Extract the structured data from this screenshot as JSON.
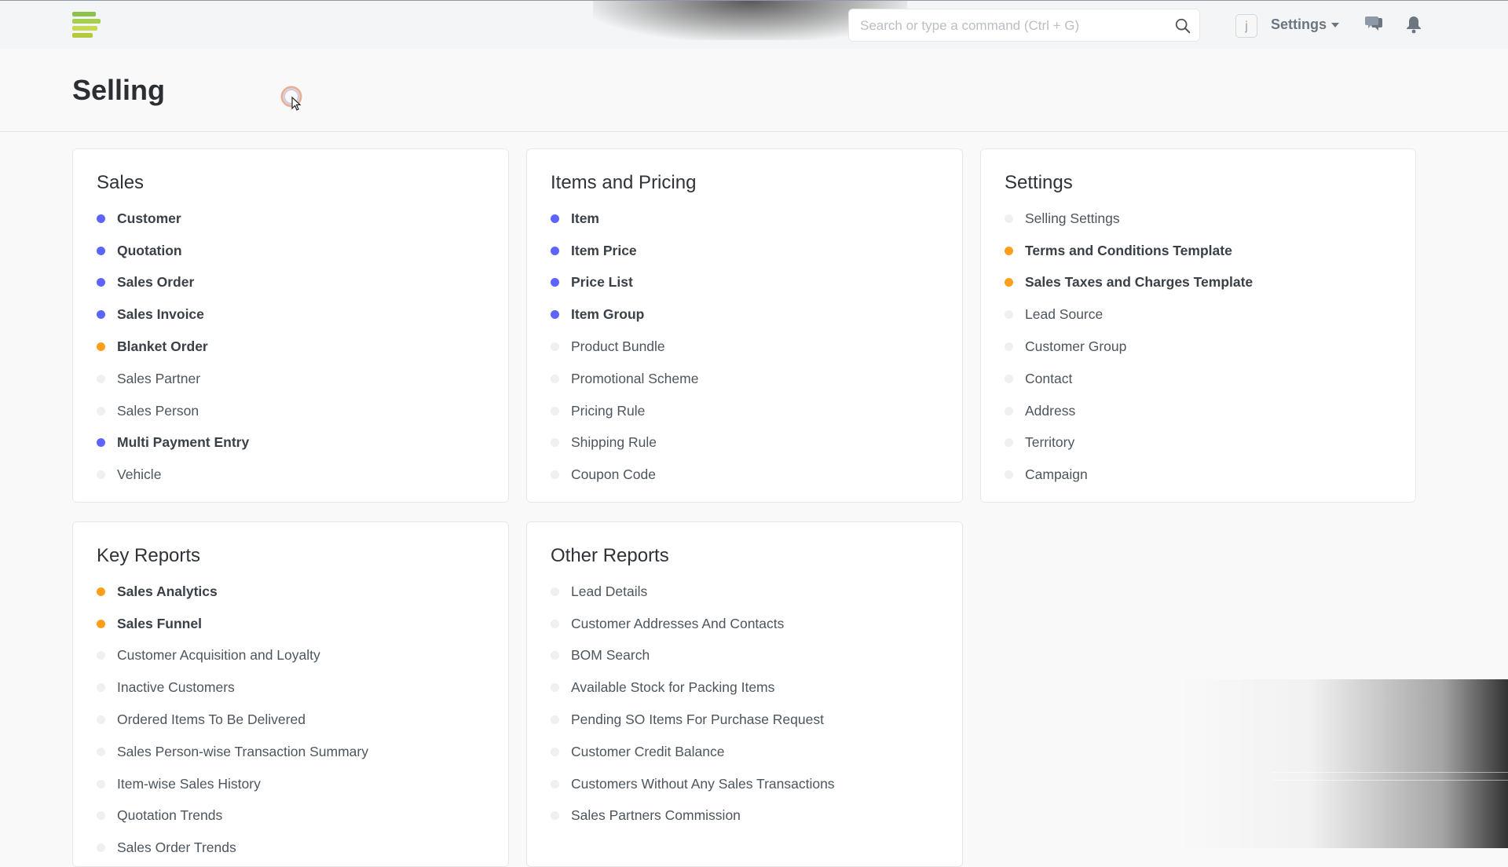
{
  "navbar": {
    "search_placeholder": "Search or type a command (Ctrl + G)",
    "avatar_initial": "j",
    "settings_label": "Settings",
    "icons": [
      "app-logo-icon",
      "search-icon",
      "chat-icon",
      "bell-icon",
      "chevron-down-icon"
    ]
  },
  "page": {
    "title": "Selling"
  },
  "colors": {
    "blue_dot": "#5e64ff",
    "orange_dot": "#ff9e1b",
    "grey_dot": "#eef0f2"
  },
  "cards": {
    "sales": {
      "title": "Sales",
      "links": [
        {
          "label": "Customer",
          "dot": "blue"
        },
        {
          "label": "Quotation",
          "dot": "blue"
        },
        {
          "label": "Sales Order",
          "dot": "blue"
        },
        {
          "label": "Sales Invoice",
          "dot": "blue"
        },
        {
          "label": "Blanket Order",
          "dot": "orange"
        },
        {
          "label": "Sales Partner",
          "dot": "grey"
        },
        {
          "label": "Sales Person",
          "dot": "grey"
        },
        {
          "label": "Multi Payment Entry",
          "dot": "blue"
        },
        {
          "label": "Vehicle",
          "dot": "grey"
        }
      ]
    },
    "items_pricing": {
      "title": "Items and Pricing",
      "links": [
        {
          "label": "Item",
          "dot": "blue"
        },
        {
          "label": "Item Price",
          "dot": "blue"
        },
        {
          "label": "Price List",
          "dot": "blue"
        },
        {
          "label": "Item Group",
          "dot": "blue"
        },
        {
          "label": "Product Bundle",
          "dot": "grey"
        },
        {
          "label": "Promotional Scheme",
          "dot": "grey"
        },
        {
          "label": "Pricing Rule",
          "dot": "grey"
        },
        {
          "label": "Shipping Rule",
          "dot": "grey"
        },
        {
          "label": "Coupon Code",
          "dot": "grey"
        }
      ]
    },
    "settings": {
      "title": "Settings",
      "links": [
        {
          "label": "Selling Settings",
          "dot": "grey"
        },
        {
          "label": "Terms and Conditions Template",
          "dot": "orange"
        },
        {
          "label": "Sales Taxes and Charges Template",
          "dot": "orange"
        },
        {
          "label": "Lead Source",
          "dot": "grey"
        },
        {
          "label": "Customer Group",
          "dot": "grey"
        },
        {
          "label": "Contact",
          "dot": "grey"
        },
        {
          "label": "Address",
          "dot": "grey"
        },
        {
          "label": "Territory",
          "dot": "grey"
        },
        {
          "label": "Campaign",
          "dot": "grey"
        }
      ]
    },
    "key_reports": {
      "title": "Key Reports",
      "links": [
        {
          "label": "Sales Analytics",
          "dot": "orange"
        },
        {
          "label": "Sales Funnel",
          "dot": "orange"
        },
        {
          "label": "Customer Acquisition and Loyalty",
          "dot": "grey"
        },
        {
          "label": "Inactive Customers",
          "dot": "grey"
        },
        {
          "label": "Ordered Items To Be Delivered",
          "dot": "grey"
        },
        {
          "label": "Sales Person-wise Transaction Summary",
          "dot": "grey"
        },
        {
          "label": "Item-wise Sales History",
          "dot": "grey"
        },
        {
          "label": "Quotation Trends",
          "dot": "grey"
        },
        {
          "label": "Sales Order Trends",
          "dot": "grey"
        }
      ]
    },
    "other_reports": {
      "title": "Other Reports",
      "links": [
        {
          "label": "Lead Details",
          "dot": "grey"
        },
        {
          "label": "Customer Addresses And Contacts",
          "dot": "grey"
        },
        {
          "label": "BOM Search",
          "dot": "grey"
        },
        {
          "label": "Available Stock for Packing Items",
          "dot": "grey"
        },
        {
          "label": "Pending SO Items For Purchase Request",
          "dot": "grey"
        },
        {
          "label": "Customer Credit Balance",
          "dot": "grey"
        },
        {
          "label": "Customers Without Any Sales Transactions",
          "dot": "grey"
        },
        {
          "label": "Sales Partners Commission",
          "dot": "grey"
        }
      ]
    }
  }
}
